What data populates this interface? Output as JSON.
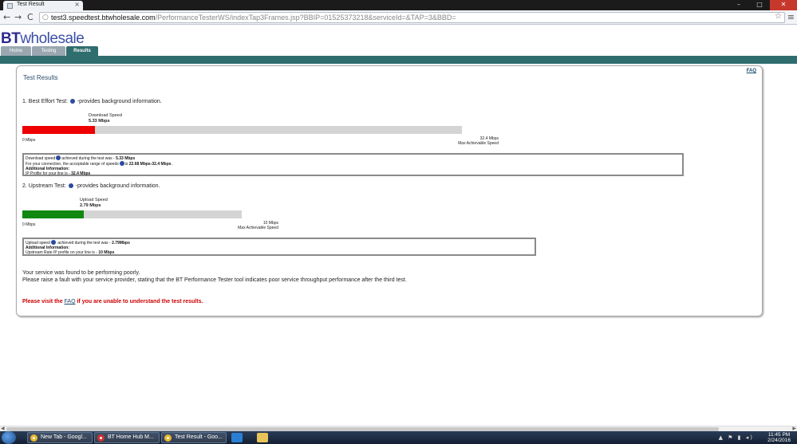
{
  "browser": {
    "tab_title": "Test Result",
    "tab_close": "×",
    "url_host": "test3.speedtest.btwholesale.com",
    "url_path": "/PerformanceTesterWS/indexTap3Frames.jsp?BBIP=01525373218&serviceId=&TAP=3&BBD=",
    "back": "←",
    "forward": "→",
    "reload": "C",
    "star": "☆",
    "menu": "≡",
    "win_min": "–",
    "win_max": "□",
    "win_close": "✕"
  },
  "header": {
    "brand_bt": "BT",
    "brand_rest": "wholesale",
    "tabs": [
      {
        "label": "Home",
        "active": false
      },
      {
        "label": "Testing",
        "active": false
      },
      {
        "label": "Results",
        "active": true
      }
    ]
  },
  "panel": {
    "faq": "FAQ",
    "title": "Test Results",
    "best_effort": {
      "heading_prefix": "1. Best Effort Test:",
      "heading_suffix": "-provides background information.",
      "caption_label": "Download Speed",
      "caption_value": "5.33 Mbps",
      "min_label": "0 Mbps",
      "max_value_label": "32.4 Mbps",
      "max_caption": "Max Achievable Speed",
      "fill_fraction": 0.1645,
      "fill_color": "#ee0000",
      "line1_pre": "Download speed",
      "line1_mid": "achieved during the test was - ",
      "line1_val": "5.33 Mbps",
      "line2_pre": "For your connection, the acceptable range of speeds",
      "line2_mid": "is ",
      "line2_val": "22.68 Mbps-32.4 Mbps",
      "line2_end": " .",
      "line3": "Additional Information:",
      "line4_pre": "IP Profile for your line is - ",
      "line4_val": "32.4 Mbps"
    },
    "upstream": {
      "heading_prefix": "2. Upstream Test:",
      "heading_suffix": "-provides background information.",
      "caption_label": "Upload Speed",
      "caption_value": "2.79 Mbps",
      "min_label": "0 Mbps",
      "max_value_label": "10 Mbps",
      "max_caption": "Max Achievable Speed",
      "fill_fraction": 0.279,
      "fill_color": "#118811",
      "line1_pre": "Upload speed",
      "line1_mid": " achieved during the test was - ",
      "line1_val": "2.79Mbps",
      "line2": "Additional Information:",
      "line3_pre": "Upstream Rate IP profile on your line is - ",
      "line3_val": "10 Mbps"
    },
    "verdict_line1": "Your service was found to be performing poorly.",
    "verdict_line2": "Please raise a fault with your service provider, stating that the BT Performance Tester tool indicates poor service throughput performance after the third test.",
    "red_pre": "Please visit the ",
    "red_link": "FAQ",
    "red_post": " if you are unable to understand the test results."
  },
  "taskbar": {
    "tasks": [
      {
        "label": "New Tab - Googl...",
        "color": "#e8b630"
      },
      {
        "label": "BT Home Hub M...",
        "color": "#c33"
      },
      {
        "label": "Test Result - Goo...",
        "color": "#e8b630"
      }
    ],
    "time": "11:45 PM",
    "date": "2/24/2016",
    "tray_icons": "▲ ⚑ ▮ ◂)"
  }
}
